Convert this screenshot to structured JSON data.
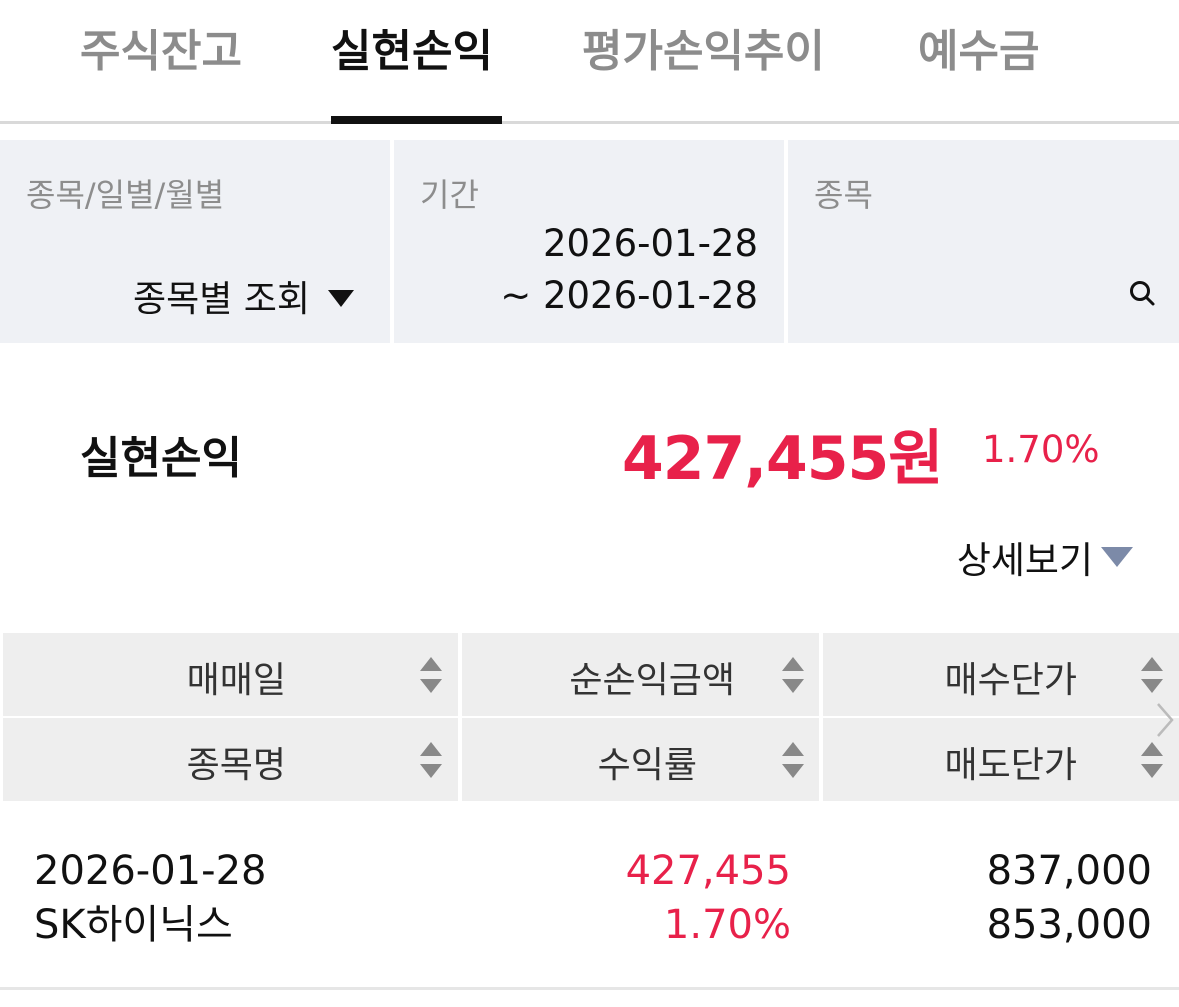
{
  "tabs": [
    {
      "label": "주식잔고",
      "active": false
    },
    {
      "label": "실현손익",
      "active": true
    },
    {
      "label": "평가손익추이",
      "active": false
    },
    {
      "label": "예수금",
      "active": false
    }
  ],
  "filters": {
    "view_label": "종목/일별/월별",
    "view_value": "종목별 조회",
    "period_label": "기간",
    "period_start": "2026-01-28",
    "period_end": "~ 2026-01-28",
    "stock_label": "종목",
    "search_icon": "search-icon"
  },
  "summary": {
    "label": "실현손익",
    "amount": "427,455원",
    "rate": "1.70%",
    "detail_toggle": "상세보기"
  },
  "table": {
    "headers_row1": [
      "매매일",
      "순손익금액",
      "매수단가"
    ],
    "headers_row2": [
      "종목명",
      "수익률",
      "매도단가"
    ],
    "rows": [
      {
        "trade_date": "2026-01-28",
        "stock_name": "SK하이닉스",
        "net_profit": "427,455",
        "return_rate": "1.70%",
        "buy_price": "837,000",
        "sell_price": "853,000"
      }
    ]
  },
  "colors": {
    "accent_red": "#e8214a",
    "filter_bg": "#eff1f5",
    "header_bg": "#eeeeee",
    "toggle_arrow": "#7c8aa8"
  }
}
